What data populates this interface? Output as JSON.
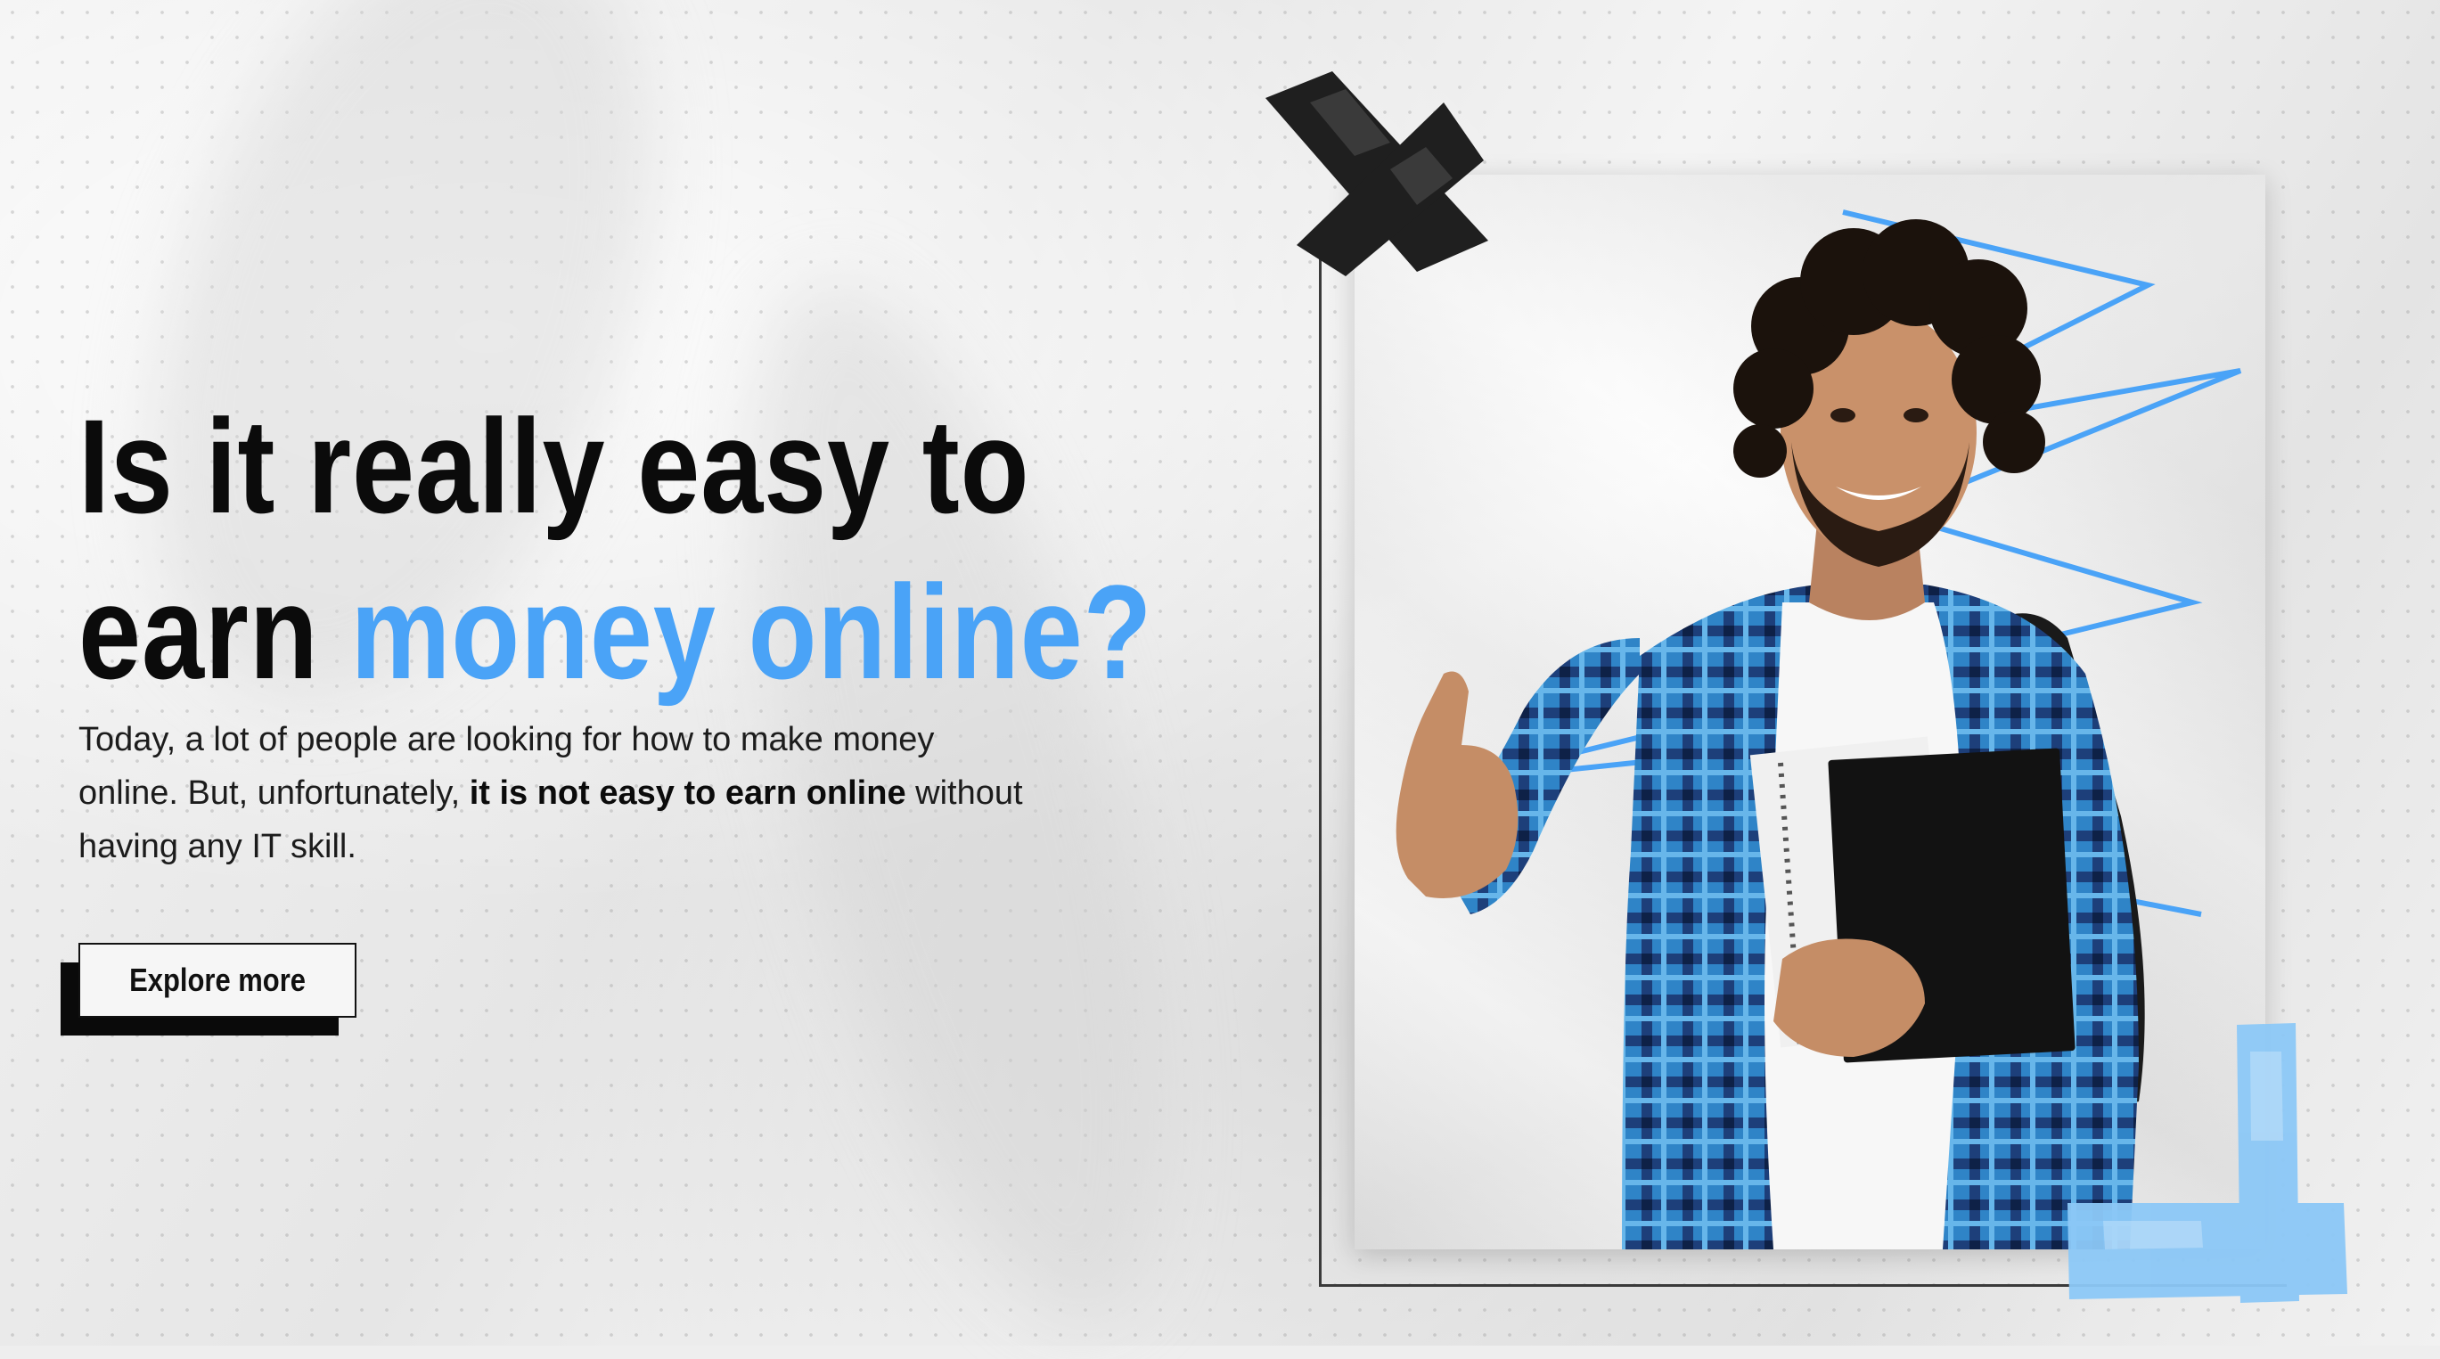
{
  "hero": {
    "headline_line1": "Is it really easy to",
    "headline_line2_plain": "earn ",
    "headline_line2_accent": "money online?",
    "body_part1": "Today, a lot of people are looking for how to make money online. But, unfortunately, ",
    "body_bold": "it is not easy to earn online",
    "body_part2": " without having any IT skill.",
    "cta_label": "Explore more"
  },
  "colors": {
    "accent": "#4aa3f7",
    "text": "#0b0b0b",
    "tape_dark": "#1f1f1f",
    "tape_blue": "#8cc8f7"
  },
  "image": {
    "alt": "Smiling student giving a thumbs up while holding notebooks",
    "icon_decor": [
      "x-tape-icon",
      "corner-tape-icon"
    ]
  }
}
